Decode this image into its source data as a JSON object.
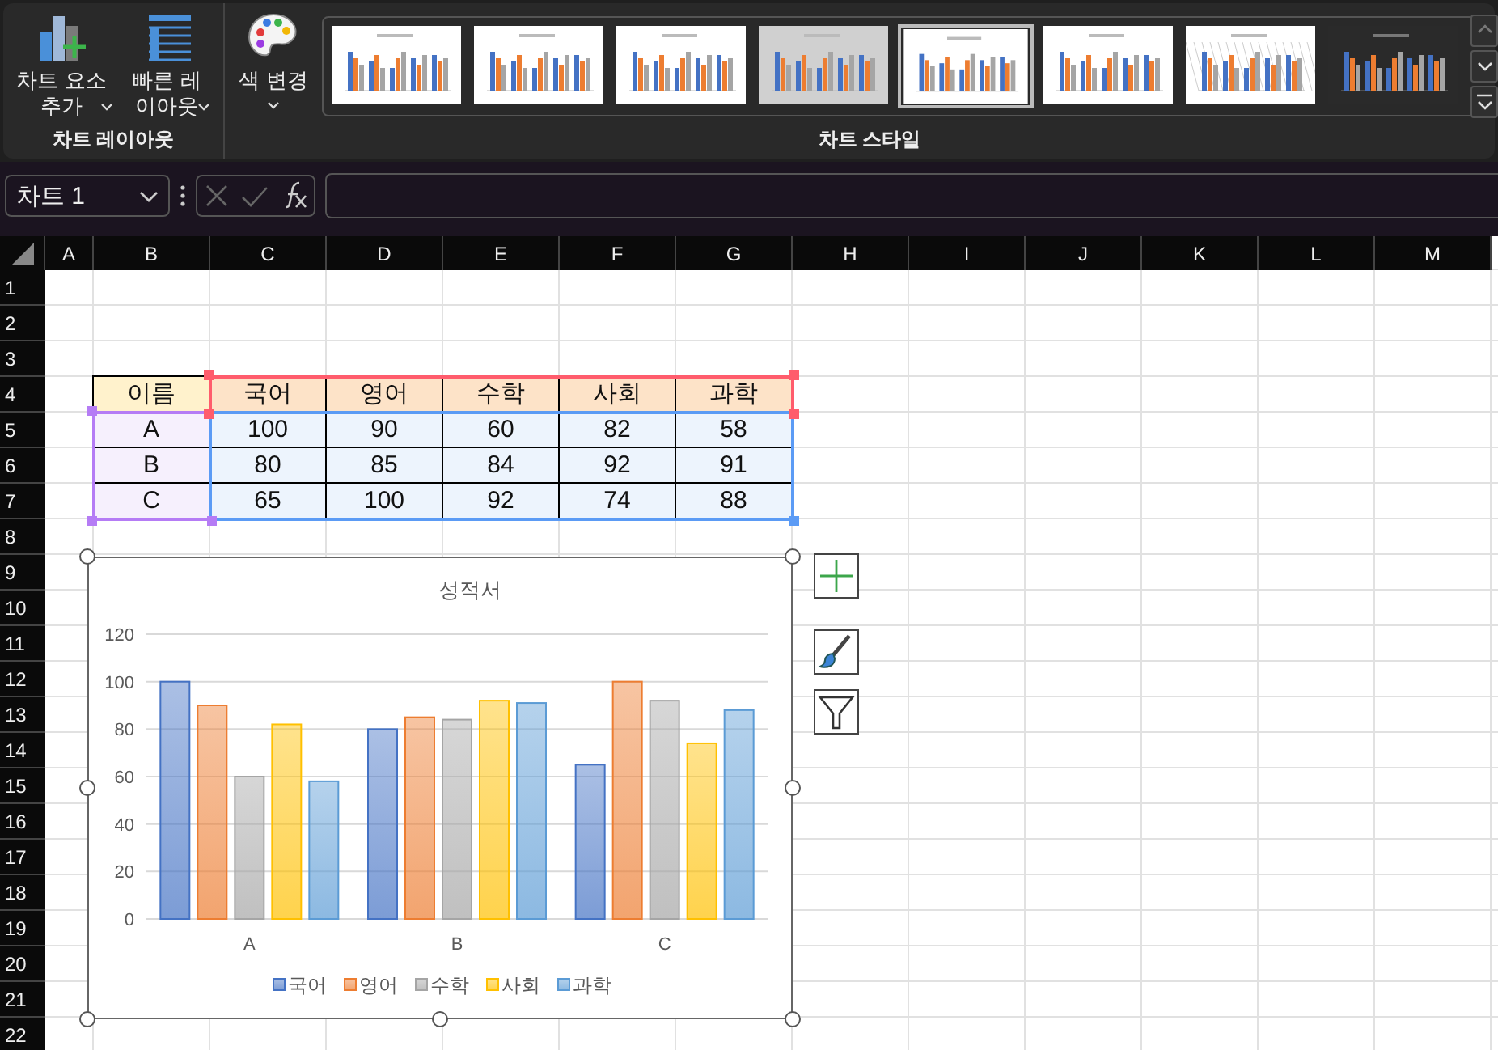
{
  "ribbon": {
    "groups": [
      {
        "label": "차트 레이아웃",
        "buttons": [
          {
            "label": "차트 요소 추가",
            "kind": "add-element"
          },
          {
            "label": "빠른 레이아웃",
            "kind": "quick-layout"
          }
        ]
      },
      {
        "label": "차트 스타일",
        "buttons": [
          {
            "label": "색 변경",
            "kind": "colors"
          }
        ],
        "gallery": [
          {
            "kind": "plain",
            "selected": false
          },
          {
            "kind": "plain",
            "selected": false
          },
          {
            "kind": "plain",
            "selected": false
          },
          {
            "kind": "gray",
            "selected": false
          },
          {
            "kind": "plain",
            "selected": true
          },
          {
            "kind": "plain",
            "selected": false
          },
          {
            "kind": "hatched",
            "selected": false
          },
          {
            "kind": "dark",
            "selected": false
          }
        ]
      }
    ]
  },
  "formula_bar": {
    "name_box": "차트 1"
  },
  "sheet": {
    "columns": [
      "A",
      "B",
      "C",
      "D",
      "E",
      "F",
      "G",
      "H",
      "I",
      "J",
      "K",
      "L",
      "M"
    ],
    "rows": [
      "1",
      "2",
      "3",
      "4",
      "5",
      "6",
      "7",
      "8",
      "9",
      "10",
      "11",
      "12",
      "13",
      "14",
      "15",
      "16",
      "17",
      "18",
      "19",
      "20",
      "21",
      "22"
    ],
    "table": {
      "header": [
        "이름",
        "국어",
        "영어",
        "수학",
        "사회",
        "과학"
      ],
      "rows": [
        [
          "A",
          "100",
          "90",
          "60",
          "82",
          "58"
        ],
        [
          "B",
          "80",
          "85",
          "84",
          "92",
          "91"
        ],
        [
          "C",
          "65",
          "100",
          "92",
          "74",
          "88"
        ]
      ]
    },
    "highlights": [
      {
        "kind": "subject-headers",
        "color": "#ff5c6c"
      },
      {
        "kind": "names",
        "color": "#b57cf5"
      },
      {
        "kind": "scores",
        "color": "#5b9bf5"
      }
    ],
    "chart": {
      "title": "성적서",
      "chart_data": {
        "type": "bar",
        "categories": [
          "A",
          "B",
          "C"
        ],
        "series": [
          {
            "name": "국어",
            "color": "#4472c4",
            "values": [
              100,
              80,
              65
            ]
          },
          {
            "name": "영어",
            "color": "#ed7d31",
            "values": [
              90,
              85,
              100
            ]
          },
          {
            "name": "수학",
            "color": "#a5a5a5",
            "values": [
              60,
              84,
              92
            ]
          },
          {
            "name": "사회",
            "color": "#ffc000",
            "values": [
              82,
              92,
              74
            ]
          },
          {
            "name": "과학",
            "color": "#5b9bd5",
            "values": [
              58,
              91,
              88
            ]
          }
        ],
        "ylim": [
          0,
          120
        ],
        "yticks": [
          0,
          20,
          40,
          60,
          80,
          100,
          120
        ],
        "grid": true,
        "legend": true
      }
    }
  }
}
